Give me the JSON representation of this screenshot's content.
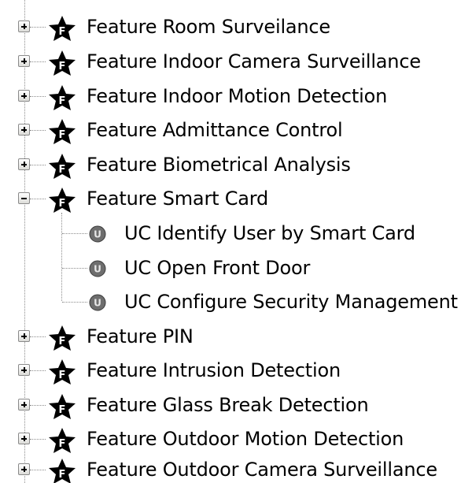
{
  "tree": {
    "nodes": [
      {
        "id": "room-surveillance",
        "label": "Feature Room Surveilance",
        "expanded": false,
        "icon": "feature-star-icon"
      },
      {
        "id": "indoor-camera-surveillance",
        "label": "Feature Indoor Camera Surveillance",
        "expanded": false,
        "icon": "feature-star-icon"
      },
      {
        "id": "indoor-motion-detection",
        "label": "Feature Indoor Motion Detection",
        "expanded": false,
        "icon": "feature-star-icon"
      },
      {
        "id": "admittance-control",
        "label": "Feature Admittance Control",
        "expanded": false,
        "icon": "feature-star-icon"
      },
      {
        "id": "biometrical-analysis",
        "label": "Feature Biometrical Analysis",
        "expanded": false,
        "icon": "feature-star-icon"
      },
      {
        "id": "smart-card",
        "label": "Feature Smart Card",
        "expanded": true,
        "icon": "feature-star-icon",
        "children": [
          {
            "id": "identify-user",
            "label": "UC Identify User by Smart Card",
            "icon": "use-case-icon"
          },
          {
            "id": "open-front-door",
            "label": "UC Open Front Door",
            "icon": "use-case-icon"
          },
          {
            "id": "configure-security",
            "label": "UC Configure Security Management",
            "icon": "use-case-icon"
          }
        ]
      },
      {
        "id": "pin",
        "label": "Feature PIN",
        "expanded": false,
        "icon": "feature-star-icon"
      },
      {
        "id": "intrusion-detection",
        "label": "Feature Intrusion Detection",
        "expanded": false,
        "icon": "feature-star-icon"
      },
      {
        "id": "glass-break-detection",
        "label": "Feature Glass Break Detection",
        "expanded": false,
        "icon": "feature-star-icon"
      },
      {
        "id": "outdoor-motion-detection",
        "label": "Feature Outdoor Motion Detection",
        "expanded": false,
        "icon": "feature-star-icon"
      },
      {
        "id": "outdoor-camera-surveillance",
        "label": "Feature Outdoor Camera Surveillance",
        "expanded": false,
        "icon": "feature-star-icon"
      }
    ]
  },
  "colors": {
    "text": "#000000",
    "guide_lines": "#8c8c8c",
    "star_fill": "#000000",
    "star_letter": "#ffffff",
    "usecase_fill": "#6e6e6e"
  }
}
